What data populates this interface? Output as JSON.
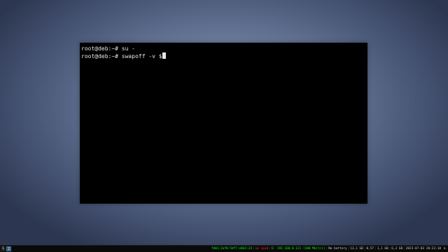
{
  "terminal": {
    "lines": [
      "root@deb:~# su -",
      "root@deb:~# swapoff -v $"
    ]
  },
  "bar": {
    "workspaces": [
      "1",
      "2"
    ],
    "active_workspace": "2",
    "status": {
      "ipv6": "fd01:2af0:5df7:e8b3:24",
      "wireless": "no ipv6",
      "ethernet": "E: 192.168.0.121 (100 Mbit/s)",
      "battery": "No battery",
      "disk": "13,1 GB",
      "load": "0,57",
      "memory_used": "1,1 GB",
      "memory_total": "6,3 GB",
      "datetime": "2023-07-03 20:23:10"
    },
    "tray_icon": "network-icon",
    "colors": {
      "ok": "#00ff00",
      "bad": "#ff3030",
      "active_ws": "#285577"
    }
  }
}
